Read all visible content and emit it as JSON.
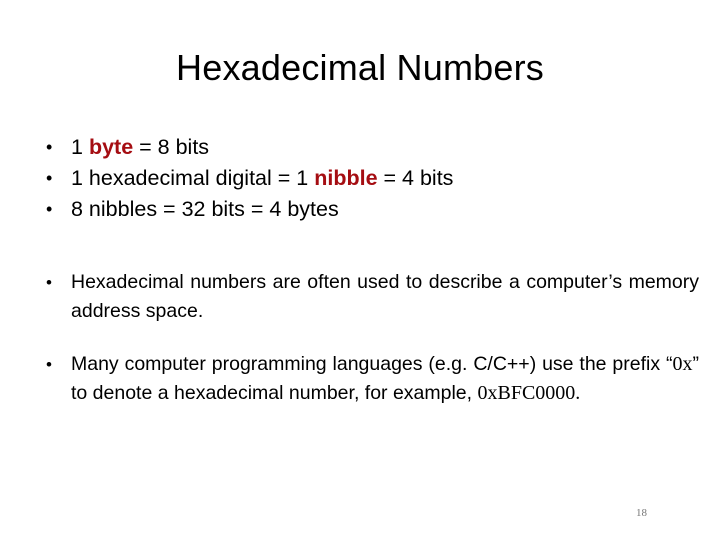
{
  "slide": {
    "title": "Hexadecimal Numbers",
    "page_number": "18",
    "accent_color": "#a50d12"
  },
  "bullets_group1": [
    {
      "pre": "1 ",
      "highlight": "byte",
      "post": " = 8 bits"
    },
    {
      "pre": "1 hexadecimal digital = 1 ",
      "highlight": "nibble",
      "post": " = 4 bits"
    },
    {
      "pre": "8 nibbles = 32 bits = 4 bytes",
      "highlight": "",
      "post": ""
    }
  ],
  "bullet_memory": "Hexadecimal numbers are often used to describe a computer’s memory address space.",
  "bullet_prefix": {
    "text1": "Many computer programming languages (e.g. C/C++) use the prefix “",
    "code_prefix": "0x",
    "text2": "” to denote a hexadecimal number, for example, ",
    "example": "0xBFC0000."
  },
  "bullet_symbol": "•"
}
